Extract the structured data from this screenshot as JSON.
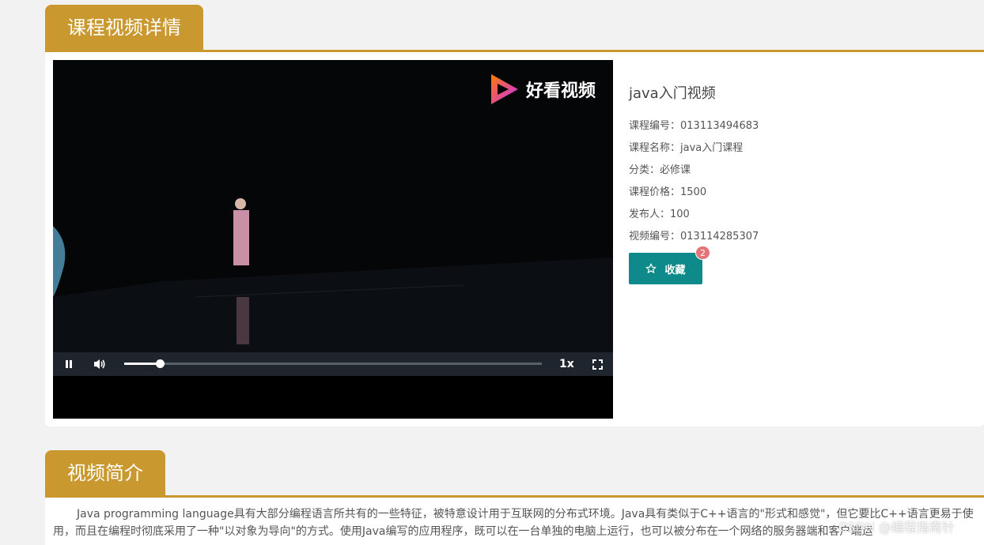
{
  "detail_section": {
    "title": "课程视频详情"
  },
  "player": {
    "logo_text": "好看视频",
    "speed_label": "1x",
    "progress_fraction": 0.085
  },
  "course": {
    "video_title": "java入门视频",
    "rows": [
      {
        "label": "课程编号：",
        "value": "013113494683"
      },
      {
        "label": "课程名称：",
        "value": "java入门课程"
      },
      {
        "label": "分类：",
        "value": "必修课"
      },
      {
        "label": "课程价格：",
        "value": "1500"
      },
      {
        "label": "发布人：",
        "value": "100"
      },
      {
        "label": "视频编号：",
        "value": "013114285307"
      }
    ],
    "favorite_label": "收藏",
    "favorite_count": "2"
  },
  "intro_section": {
    "title": "视频简介",
    "text": "Java programming language具有大部分编程语言所共有的一些特征，被特意设计用于互联网的分布式环境。Java具有类似于C++语言的\"形式和感觉\"，但它要比C++语言更易于使用，而且在编程时彻底采用了一种\"以对象为导向\"的方式。使用Java编写的应用程序，既可以在一台单独的电脑上运行，也可以被分布在一个网络的服务器端和客户端运"
  },
  "watermark": "CSDN @编程指南针",
  "colors": {
    "accent": "#c9982f",
    "favorite": "#0e8a8a",
    "badge": "#e5747a"
  }
}
